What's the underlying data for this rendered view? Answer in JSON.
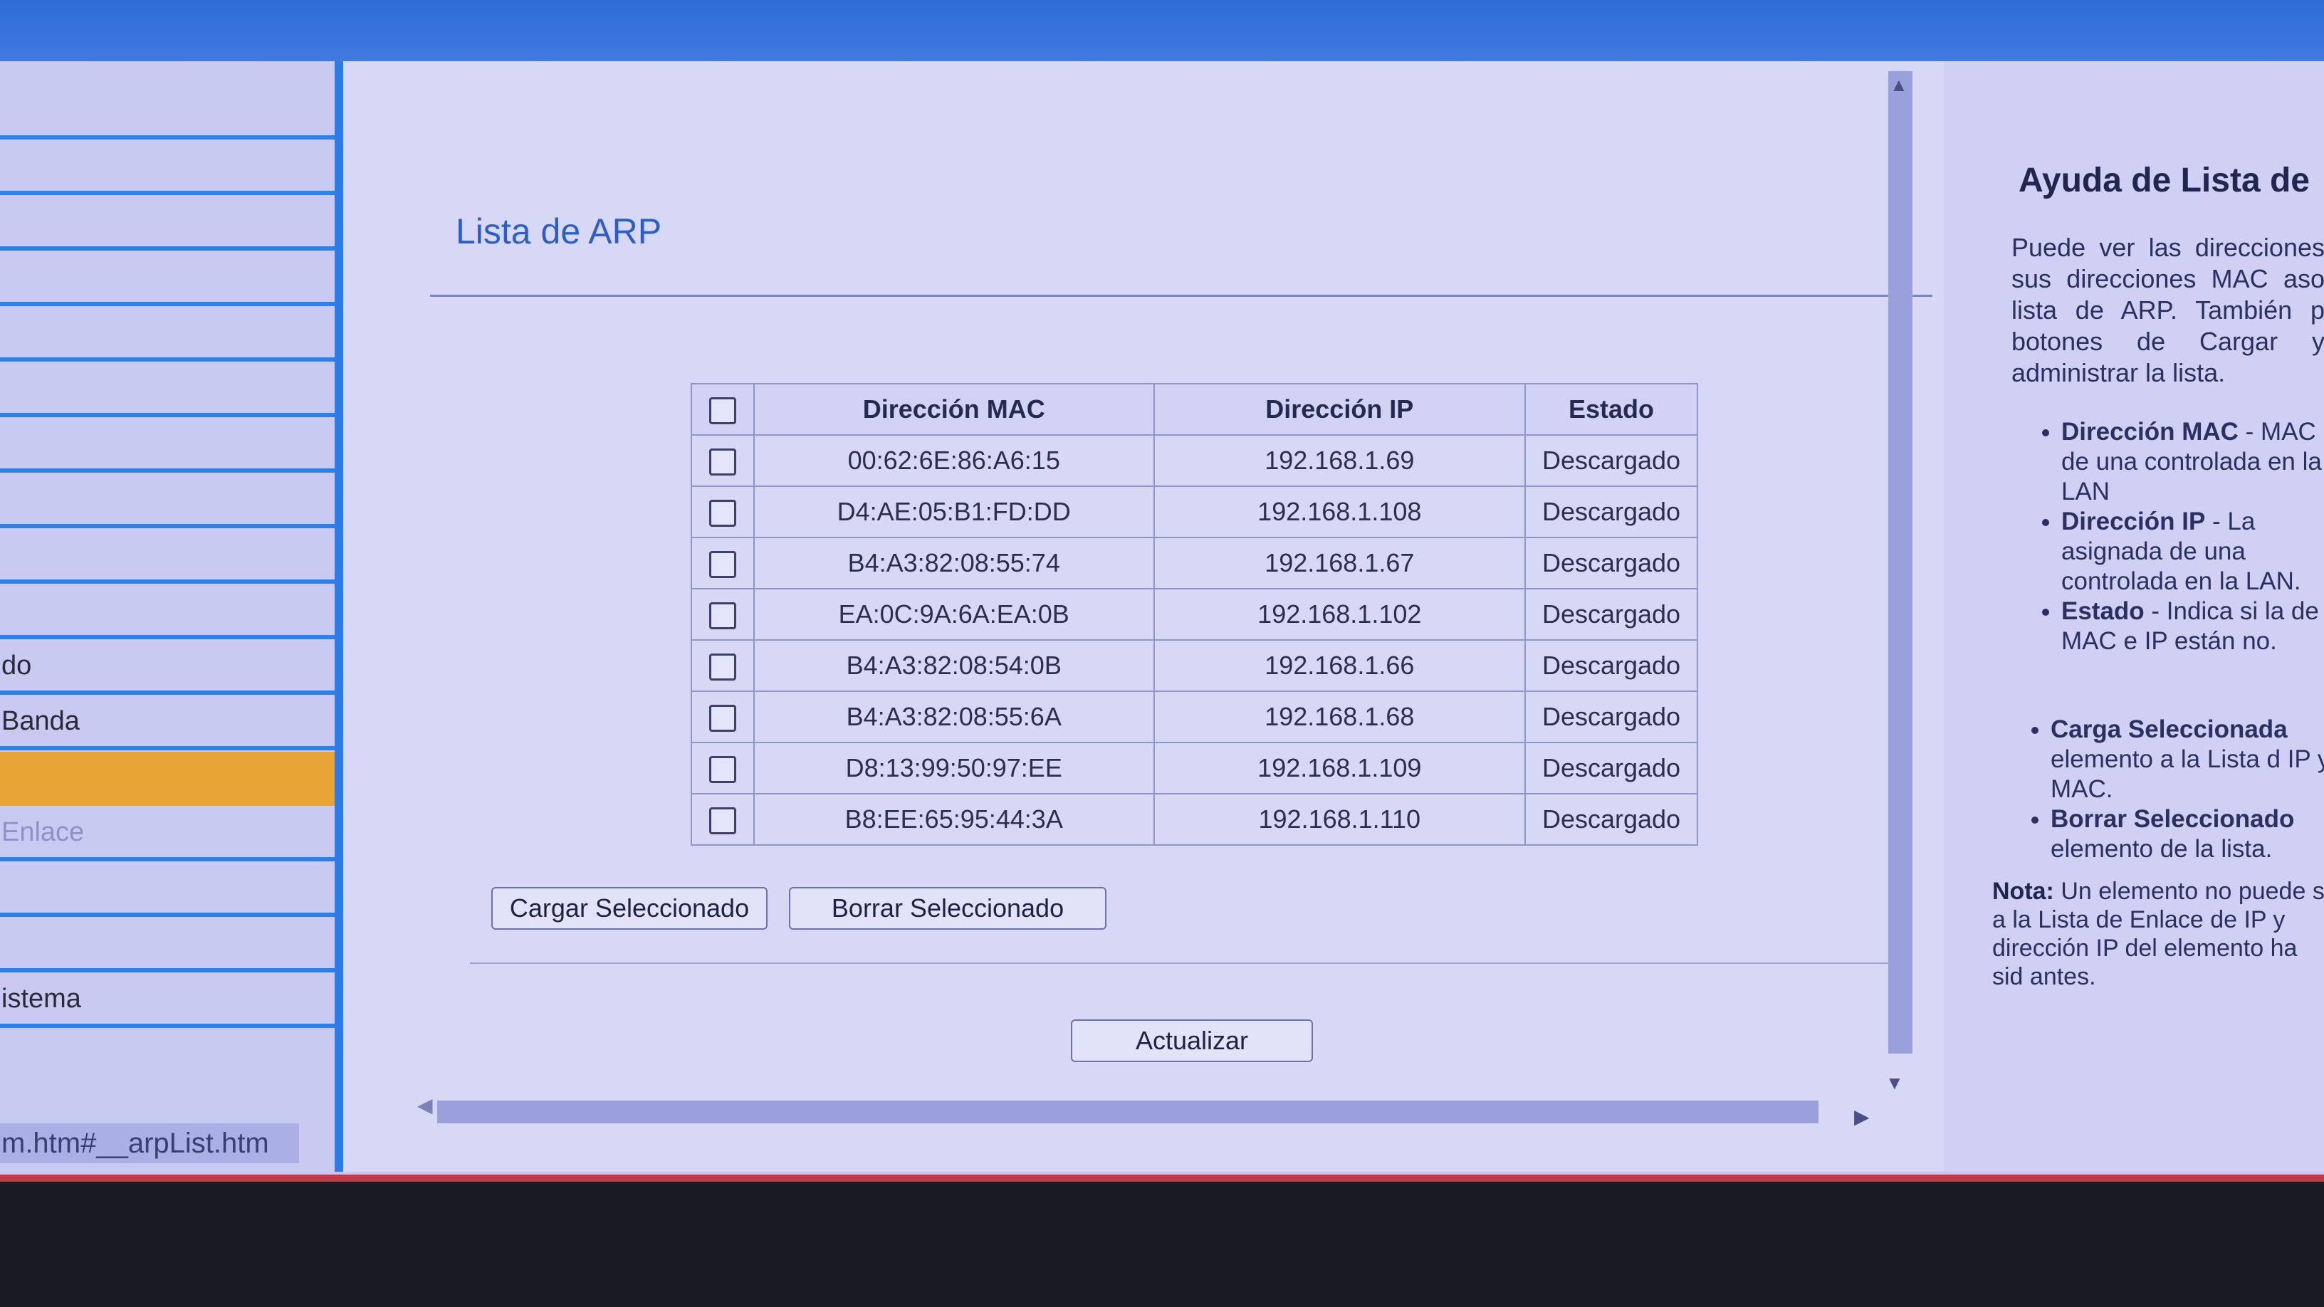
{
  "sidebar": {
    "items": [
      {
        "label": ""
      },
      {
        "label": ""
      },
      {
        "label": ""
      },
      {
        "label": ""
      },
      {
        "label": ""
      },
      {
        "label": ""
      },
      {
        "label": ""
      },
      {
        "label": ""
      },
      {
        "label": ""
      },
      {
        "label": ""
      },
      {
        "label": "do"
      },
      {
        "label": "Banda"
      },
      {
        "label": ""
      },
      {
        "label": "Enlace"
      },
      {
        "label": ""
      },
      {
        "label": ""
      },
      {
        "label": "istema"
      }
    ],
    "status_url": "m.htm#__arpList.htm"
  },
  "main": {
    "title": "Lista de ARP",
    "table": {
      "headers": [
        "Dirección MAC",
        "Dirección IP",
        "Estado"
      ],
      "rows": [
        {
          "mac": "00:62:6E:86:A6:15",
          "ip": "192.168.1.69",
          "estado": "Descargado"
        },
        {
          "mac": "D4:AE:05:B1:FD:DD",
          "ip": "192.168.1.108",
          "estado": "Descargado"
        },
        {
          "mac": "B4:A3:82:08:55:74",
          "ip": "192.168.1.67",
          "estado": "Descargado"
        },
        {
          "mac": "EA:0C:9A:6A:EA:0B",
          "ip": "192.168.1.102",
          "estado": "Descargado"
        },
        {
          "mac": "B4:A3:82:08:54:0B",
          "ip": "192.168.1.66",
          "estado": "Descargado"
        },
        {
          "mac": "B4:A3:82:08:55:6A",
          "ip": "192.168.1.68",
          "estado": "Descargado"
        },
        {
          "mac": "D8:13:99:50:97:EE",
          "ip": "192.168.1.109",
          "estado": "Descargado"
        },
        {
          "mac": "B8:EE:65:95:44:3A",
          "ip": "192.168.1.110",
          "estado": "Descargado"
        }
      ]
    },
    "buttons": {
      "load": "Cargar Seleccionado",
      "delete": "Borrar Seleccionado",
      "refresh": "Actualizar"
    }
  },
  "help": {
    "title": "Ayuda de Lista de",
    "intro": "Puede ver las direcciones sus direcciones MAC aso lista de ARP. También p botones de Cargar y administrar la lista.",
    "list1": [
      {
        "term": "Dirección MAC",
        "text": " - MAC de una controlada en la LAN"
      },
      {
        "term": "Dirección IP",
        "text": " - La asignada de una controlada en la LAN."
      },
      {
        "term": "Estado",
        "text": " - Indica si la de MAC e IP están no."
      }
    ],
    "list2": [
      {
        "term": "Carga Seleccionada",
        "text": " elemento a la Lista d IP y MAC."
      },
      {
        "term": "Borrar Seleccionado",
        "text": " elemento de la lista."
      }
    ],
    "note_label": "Nota:",
    "note_text": " Un elemento no puede s a la Lista de Enlace de IP y dirección IP del elemento ha sid antes."
  },
  "colors": {
    "accent_blue": "#2b7ce8",
    "active_item": "#e6a535",
    "title_blue": "#2c5fc5"
  }
}
